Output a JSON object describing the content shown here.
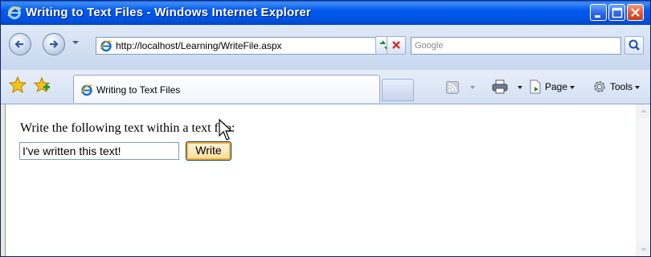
{
  "window": {
    "title": "Writing to Text Files - Windows Internet Explorer"
  },
  "navigation": {
    "address_url": "http://localhost/Learning/WriteFile.aspx",
    "search_placeholder": "Google"
  },
  "tabs": [
    {
      "label": "Writing to Text Files",
      "active": true
    }
  ],
  "command_bar": {
    "page_label": "Page",
    "tools_label": "Tools"
  },
  "page": {
    "prompt_text": "Write the following text within a text file:",
    "input_value": "I've written this text!",
    "write_button_label": "Write"
  },
  "colors": {
    "titlebar_blue": "#0058EE",
    "close_red": "#E2572F",
    "button_focus_orange": "#F8B33A"
  },
  "icons": [
    "ie-icon",
    "back-icon",
    "forward-icon",
    "refresh-icon",
    "stop-icon",
    "search-icon",
    "favorites-star-icon",
    "add-favorites-icon",
    "rss-feed-icon",
    "print-icon",
    "page-icon",
    "tools-gear-icon",
    "mouse-cursor-icon"
  ]
}
